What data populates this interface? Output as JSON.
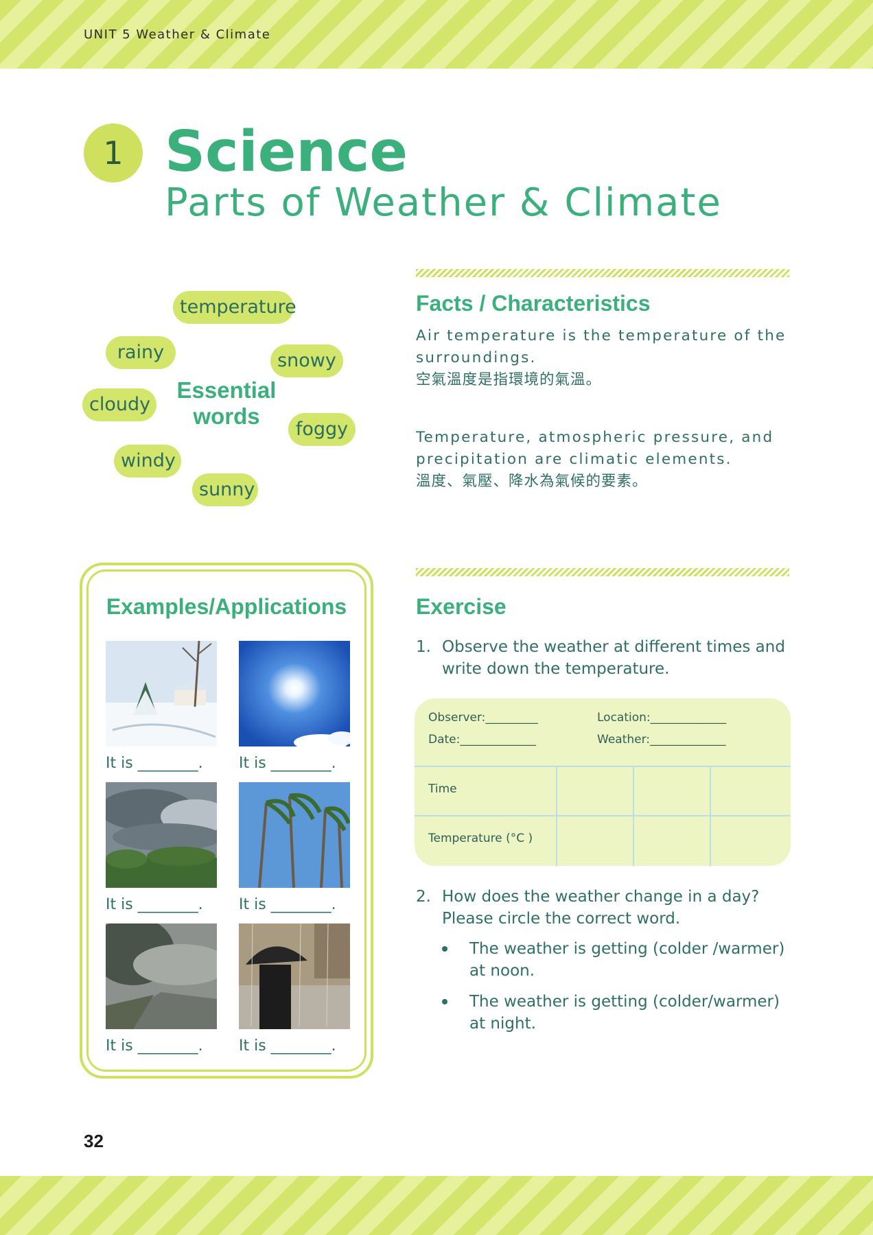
{
  "header": {
    "unit_label": "UNIT 5  Weather & Climate"
  },
  "title_block": {
    "number": "1",
    "title": "Science",
    "subtitle": "Parts of Weather & Climate"
  },
  "essential_words": {
    "center_label_line1": "Essential",
    "center_label_line2": "words",
    "words": [
      "temperature",
      "rainy",
      "snowy",
      "cloudy",
      "foggy",
      "windy",
      "sunny"
    ]
  },
  "facts": {
    "heading": "Facts / Characteristics",
    "p1_en": "Air temperature is the temperature of the surroundings.",
    "p1_zh": "空氣溫度是指環境的氣溫。",
    "p2_en": "Temperature, atmospheric pressure, and precipitation are climatic elements.",
    "p2_zh": "溫度、氣壓、降水為氣候的要素。"
  },
  "examples": {
    "heading": "Examples/Applications",
    "photos": [
      {
        "icon": "snowy-scene-photo",
        "caption": "It is ________."
      },
      {
        "icon": "sunny-sky-photo",
        "caption": "It is ________."
      },
      {
        "icon": "cloudy-sky-photo",
        "caption": "It is ________."
      },
      {
        "icon": "windy-palms-photo",
        "caption": "It is ________."
      },
      {
        "icon": "foggy-road-photo",
        "caption": "It is ________."
      },
      {
        "icon": "rainy-umbrella-photo",
        "caption": "It is ________."
      }
    ]
  },
  "exercise": {
    "heading": "Exercise",
    "q1_num": "1.",
    "q1_text": "Observe the weather at different times and write down the temperature.",
    "table": {
      "observer": "Observer:_________",
      "location": "Location:_____________",
      "date": "Date:_____________",
      "weather": "Weather:_____________",
      "row1_label": "Time",
      "row2_label": "Temperature (°C )"
    },
    "q2_num": "2.",
    "q2_text": "How does the weather change in a day? Please circle the correct word.",
    "bullets": [
      "The weather is getting (colder /warmer) at noon.",
      "The weather is getting (colder/warmer) at night."
    ]
  },
  "footer": {
    "page_number": "32"
  },
  "colors": {
    "accent_green": "#3bb07c",
    "lime": "#d3e56a",
    "text_teal": "#2f6f66",
    "table_bg": "#eef5c4"
  }
}
